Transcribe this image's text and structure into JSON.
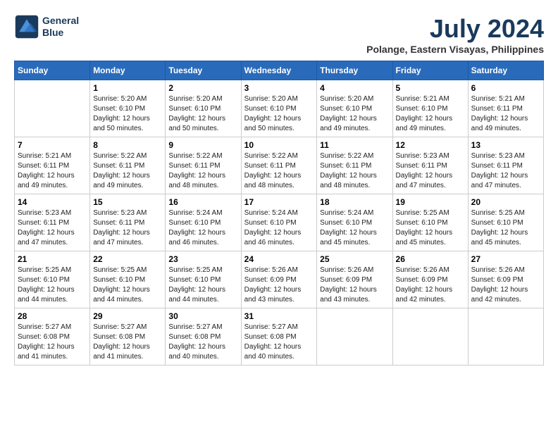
{
  "header": {
    "logo_line1": "General",
    "logo_line2": "Blue",
    "month": "July 2024",
    "location": "Polange, Eastern Visayas, Philippines"
  },
  "weekdays": [
    "Sunday",
    "Monday",
    "Tuesday",
    "Wednesday",
    "Thursday",
    "Friday",
    "Saturday"
  ],
  "weeks": [
    [
      {
        "day": "",
        "text": ""
      },
      {
        "day": "1",
        "text": "Sunrise: 5:20 AM\nSunset: 6:10 PM\nDaylight: 12 hours\nand 50 minutes."
      },
      {
        "day": "2",
        "text": "Sunrise: 5:20 AM\nSunset: 6:10 PM\nDaylight: 12 hours\nand 50 minutes."
      },
      {
        "day": "3",
        "text": "Sunrise: 5:20 AM\nSunset: 6:10 PM\nDaylight: 12 hours\nand 50 minutes."
      },
      {
        "day": "4",
        "text": "Sunrise: 5:20 AM\nSunset: 6:10 PM\nDaylight: 12 hours\nand 49 minutes."
      },
      {
        "day": "5",
        "text": "Sunrise: 5:21 AM\nSunset: 6:10 PM\nDaylight: 12 hours\nand 49 minutes."
      },
      {
        "day": "6",
        "text": "Sunrise: 5:21 AM\nSunset: 6:11 PM\nDaylight: 12 hours\nand 49 minutes."
      }
    ],
    [
      {
        "day": "7",
        "text": "Sunrise: 5:21 AM\nSunset: 6:11 PM\nDaylight: 12 hours\nand 49 minutes."
      },
      {
        "day": "8",
        "text": "Sunrise: 5:22 AM\nSunset: 6:11 PM\nDaylight: 12 hours\nand 49 minutes."
      },
      {
        "day": "9",
        "text": "Sunrise: 5:22 AM\nSunset: 6:11 PM\nDaylight: 12 hours\nand 48 minutes."
      },
      {
        "day": "10",
        "text": "Sunrise: 5:22 AM\nSunset: 6:11 PM\nDaylight: 12 hours\nand 48 minutes."
      },
      {
        "day": "11",
        "text": "Sunrise: 5:22 AM\nSunset: 6:11 PM\nDaylight: 12 hours\nand 48 minutes."
      },
      {
        "day": "12",
        "text": "Sunrise: 5:23 AM\nSunset: 6:11 PM\nDaylight: 12 hours\nand 47 minutes."
      },
      {
        "day": "13",
        "text": "Sunrise: 5:23 AM\nSunset: 6:11 PM\nDaylight: 12 hours\nand 47 minutes."
      }
    ],
    [
      {
        "day": "14",
        "text": "Sunrise: 5:23 AM\nSunset: 6:11 PM\nDaylight: 12 hours\nand 47 minutes."
      },
      {
        "day": "15",
        "text": "Sunrise: 5:23 AM\nSunset: 6:11 PM\nDaylight: 12 hours\nand 47 minutes."
      },
      {
        "day": "16",
        "text": "Sunrise: 5:24 AM\nSunset: 6:10 PM\nDaylight: 12 hours\nand 46 minutes."
      },
      {
        "day": "17",
        "text": "Sunrise: 5:24 AM\nSunset: 6:10 PM\nDaylight: 12 hours\nand 46 minutes."
      },
      {
        "day": "18",
        "text": "Sunrise: 5:24 AM\nSunset: 6:10 PM\nDaylight: 12 hours\nand 45 minutes."
      },
      {
        "day": "19",
        "text": "Sunrise: 5:25 AM\nSunset: 6:10 PM\nDaylight: 12 hours\nand 45 minutes."
      },
      {
        "day": "20",
        "text": "Sunrise: 5:25 AM\nSunset: 6:10 PM\nDaylight: 12 hours\nand 45 minutes."
      }
    ],
    [
      {
        "day": "21",
        "text": "Sunrise: 5:25 AM\nSunset: 6:10 PM\nDaylight: 12 hours\nand 44 minutes."
      },
      {
        "day": "22",
        "text": "Sunrise: 5:25 AM\nSunset: 6:10 PM\nDaylight: 12 hours\nand 44 minutes."
      },
      {
        "day": "23",
        "text": "Sunrise: 5:25 AM\nSunset: 6:10 PM\nDaylight: 12 hours\nand 44 minutes."
      },
      {
        "day": "24",
        "text": "Sunrise: 5:26 AM\nSunset: 6:09 PM\nDaylight: 12 hours\nand 43 minutes."
      },
      {
        "day": "25",
        "text": "Sunrise: 5:26 AM\nSunset: 6:09 PM\nDaylight: 12 hours\nand 43 minutes."
      },
      {
        "day": "26",
        "text": "Sunrise: 5:26 AM\nSunset: 6:09 PM\nDaylight: 12 hours\nand 42 minutes."
      },
      {
        "day": "27",
        "text": "Sunrise: 5:26 AM\nSunset: 6:09 PM\nDaylight: 12 hours\nand 42 minutes."
      }
    ],
    [
      {
        "day": "28",
        "text": "Sunrise: 5:27 AM\nSunset: 6:08 PM\nDaylight: 12 hours\nand 41 minutes."
      },
      {
        "day": "29",
        "text": "Sunrise: 5:27 AM\nSunset: 6:08 PM\nDaylight: 12 hours\nand 41 minutes."
      },
      {
        "day": "30",
        "text": "Sunrise: 5:27 AM\nSunset: 6:08 PM\nDaylight: 12 hours\nand 40 minutes."
      },
      {
        "day": "31",
        "text": "Sunrise: 5:27 AM\nSunset: 6:08 PM\nDaylight: 12 hours\nand 40 minutes."
      },
      {
        "day": "",
        "text": ""
      },
      {
        "day": "",
        "text": ""
      },
      {
        "day": "",
        "text": ""
      }
    ]
  ]
}
